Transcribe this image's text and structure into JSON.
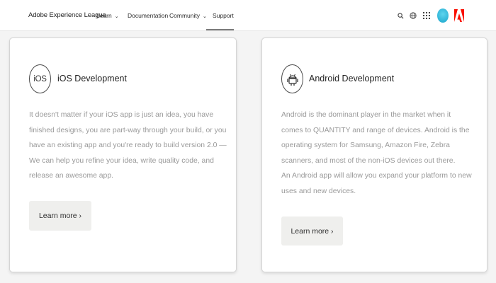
{
  "header": {
    "brand": "Adobe Experience League",
    "nav": [
      {
        "label": "Learn",
        "chevron": "⌄"
      },
      {
        "label": "Documentation"
      },
      {
        "label": "Community",
        "chevron": "⌄"
      },
      {
        "label": "Support"
      }
    ],
    "active_nav": "Support",
    "icons": [
      "search-icon",
      "globe-icon",
      "apps-grid-icon",
      "user-avatar",
      "adobe-logo"
    ],
    "colors": {
      "avatar": "#1ba6cc",
      "adobe_logo": "#fa0f00"
    }
  },
  "cards": [
    {
      "icon_text": "iOS",
      "title": "iOS Development",
      "body": [
        "It doesn't matter if your iOS app is just an idea, you have finished designs, you are part-way through your build, or you have an existing app and you're ready to build version 2.0 — We can help you refine your idea, write quality code, and release an awesome app."
      ],
      "button": "Learn more ›"
    },
    {
      "icon": "android-icon",
      "title": "Android Development",
      "body": [
        "Android is the dominant player in the market when it comes to QUANTITY and range of devices. Android is the operating system for Samsung, Amazon Fire, Zebra scanners, and most of the non-iOS devices out there.",
        "An Android app will allow you expand your platform to new uses and new devices."
      ],
      "button": "Learn more ›"
    }
  ]
}
